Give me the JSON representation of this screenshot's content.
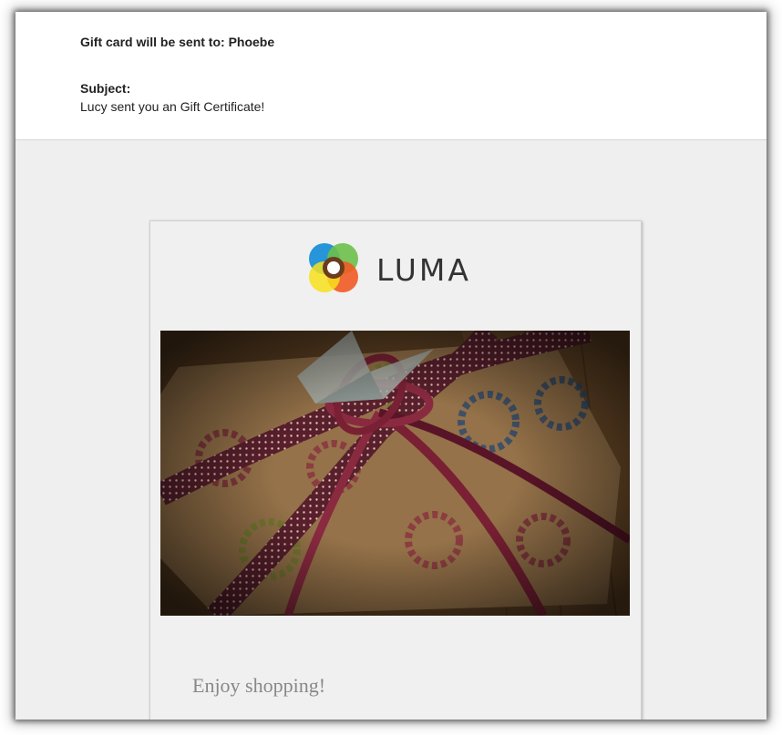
{
  "email": {
    "sent_to_line": "Gift card will be sent to: Phoebe",
    "subject_label": "Subject:",
    "subject_text": "Lucy sent you an Gift Certificate!"
  },
  "card": {
    "logo_text": "LUMA",
    "hero_image": "gift-box-photo",
    "greeting": "Enjoy shopping!"
  },
  "colors": {
    "logo_blue": "#1a8fd8",
    "logo_green": "#6cc04a",
    "logo_orange": "#f15a24",
    "logo_yellow": "#f7e01b",
    "card_bg": "#f0f0f0",
    "page_bg": "#efefef"
  }
}
